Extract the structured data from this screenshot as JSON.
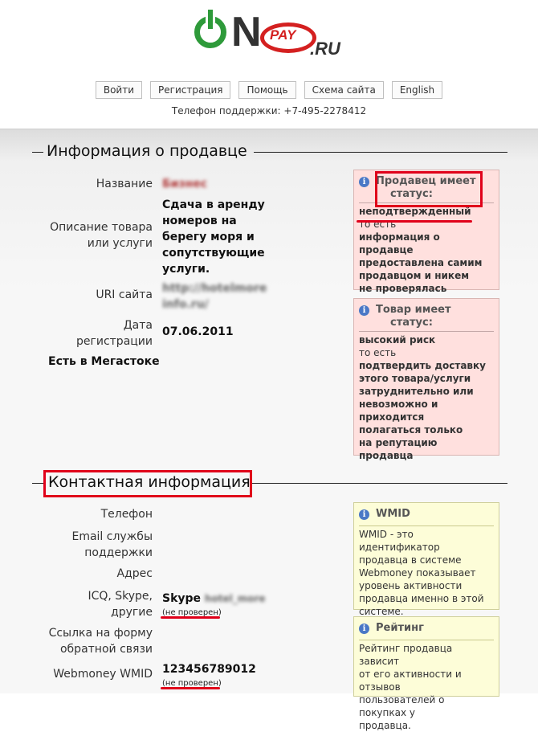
{
  "header": {
    "logo": {
      "on": "N",
      "pay": "PAY",
      "ru": ".RU"
    },
    "nav": [
      "Войти",
      "Регистрация",
      "Помощь",
      "Схема сайта",
      "English"
    ],
    "support_phone": "Телефон поддержки: +7-495-2278412"
  },
  "seller_section": {
    "title": "Информация о продавце",
    "fields": {
      "name_label": "Название",
      "name_value": "Бизнес",
      "desc_label_1": "Описание товара",
      "desc_label_2": "или услуги",
      "desc_value": [
        "Сдача в аренду",
        "номеров на",
        "берегу моря и",
        "сопутствующие",
        "услуги."
      ],
      "uri_label": "URI сайта",
      "uri_value": [
        "http://hotelmore",
        "info.ru/"
      ],
      "date_label_1": "Дата",
      "date_label_2": "регистрации",
      "date_value": "07.06.2011",
      "megastock": "Есть в Мегастоке"
    },
    "seller_status_box": {
      "icon": "info-icon",
      "title_1": "Продавец имеет",
      "title_2": "статус:",
      "status": "неподтвержденный",
      "to_est": "то есть",
      "explain": [
        "информация о продавце",
        "предоставлена самим",
        "продавцом и никем",
        "не проверялась"
      ]
    },
    "goods_status_box": {
      "icon": "info-icon",
      "title_1": "Товар имеет",
      "title_2": "статус:",
      "status": "высокий риск",
      "to_est": "то есть",
      "explain": [
        "подтвердить доставку",
        "этого товара/услуги",
        "затруднительно или",
        "невозможно и",
        "приходится",
        "полагаться только",
        "на репутацию продавца"
      ]
    }
  },
  "contact_section": {
    "title": "Контактная информация",
    "fields": {
      "phone_label": "Телефон",
      "email_label_1": "Email службы",
      "email_label_2": "поддержки",
      "address_label": "Адрес",
      "icq_label_1": "ICQ, Skype,",
      "icq_label_2": "другие",
      "skype_value": "Skype",
      "skype_hidden": "hotel_more",
      "not_verified_1": "(не проверен)",
      "feedback_label_1": "Ссылка на форму",
      "feedback_label_2": "обратной связи",
      "wmid_label": "Webmoney WMID",
      "wmid_value": "123456789012",
      "not_verified_2": "(не проверен)"
    },
    "wmid_box": {
      "icon": "info-icon",
      "title": "WMID",
      "text": [
        "WMID - это идентификатор",
        "продавца в системе",
        "Webmoney показывает",
        "уровень активности",
        "продавца именно в этой",
        "системе."
      ]
    },
    "rating_box": {
      "icon": "info-icon",
      "title": "Рейтинг",
      "text": [
        "Рейтинг продавца зависит",
        "от его активности и отзывов",
        "пользователей о покупках у",
        "продавца."
      ]
    }
  },
  "colors": {
    "green": "#2e9a3a",
    "red": "#d42020",
    "highlight": "#e0001a",
    "pink_box": "#ffe0de",
    "yellow_box": "#fdfdd8",
    "icon_blue": "#4a78c6"
  }
}
